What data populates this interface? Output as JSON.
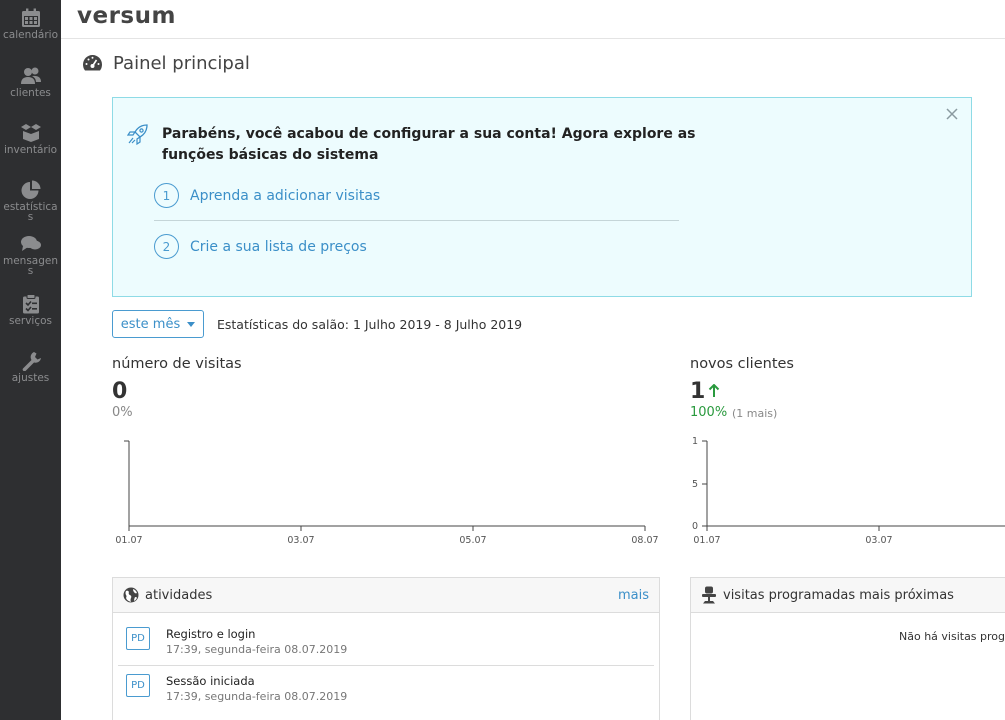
{
  "sidebar": {
    "items": [
      {
        "label": "calendário",
        "icon": "calendar-icon"
      },
      {
        "label": "clientes",
        "icon": "users-icon"
      },
      {
        "label": "inventário",
        "icon": "boxes-icon"
      },
      {
        "label": "estatísticas",
        "icon": "pie-chart-icon"
      },
      {
        "label": "mensagens",
        "icon": "chat-icon"
      },
      {
        "label": "serviços",
        "icon": "clipboard-icon"
      },
      {
        "label": "ajustes",
        "icon": "wrench-icon"
      }
    ]
  },
  "header": {
    "logo": "versum"
  },
  "page": {
    "title": "Painel principal"
  },
  "banner": {
    "title": "Parabéns, você acabou de configurar a sua conta! Agora explore as funções básicas do sistema",
    "steps": [
      {
        "num": "1",
        "label": "Aprenda a adicionar visitas"
      },
      {
        "num": "2",
        "label": "Crie a sua lista de preços"
      }
    ]
  },
  "filter": {
    "period_label": "este mês",
    "stats_text": "Estatísticas do salão: 1 Julho 2019 - 8 Julho 2019"
  },
  "stats": {
    "visits": {
      "label": "número de visitas",
      "value": "0",
      "pct": "0%"
    },
    "clients": {
      "label": "novos clientes",
      "value": "1",
      "pct": "100%",
      "extra": "(1 mais)"
    }
  },
  "chart_data": [
    {
      "type": "line",
      "x": [
        "01.07",
        "03.07",
        "05.07",
        "08.07"
      ],
      "series": [
        {
          "values": [
            0,
            0,
            0,
            0
          ]
        }
      ]
    },
    {
      "type": "line",
      "x": [
        "01.07",
        "03.07"
      ],
      "yticks": [
        "1",
        "5",
        "0"
      ],
      "series": [
        {
          "values": [
            0,
            0
          ]
        }
      ]
    }
  ],
  "activities": {
    "title": "atividades",
    "more": "mais",
    "items": [
      {
        "badge": "PD",
        "title": "Registro e login",
        "time": "17:39, segunda-feira 08.07.2019"
      },
      {
        "badge": "PD",
        "title": "Sessão iniciada",
        "time": "17:39, segunda-feira 08.07.2019"
      }
    ]
  },
  "upcoming": {
    "title": "visitas programadas mais próximas",
    "empty": "Não há visitas programadas"
  },
  "colors": {
    "accent": "#3b8fc8",
    "positive": "#2a9a3e",
    "banner_bg": "#edfcfe",
    "sidebar": "#2e2f31"
  }
}
